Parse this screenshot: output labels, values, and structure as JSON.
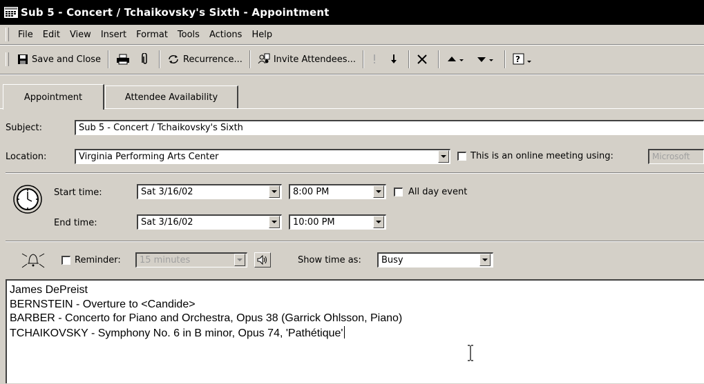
{
  "window": {
    "title": "Sub 5 - Concert / Tchaikovsky's Sixth - Appointment"
  },
  "menu": [
    "File",
    "Edit",
    "View",
    "Insert",
    "Format",
    "Tools",
    "Actions",
    "Help"
  ],
  "toolbar": {
    "save_close_label": "Save and Close",
    "recurrence_label": "Recurrence...",
    "invite_label": "Invite Attendees..."
  },
  "tabs": [
    {
      "label": "Appointment",
      "active": true
    },
    {
      "label": "Attendee Availability",
      "active": false
    }
  ],
  "form": {
    "subject_label": "Subject:",
    "subject_value": "Sub 5 - Concert / Tchaikovsky's Sixth",
    "location_label": "Location:",
    "location_value": "Virginia Performing Arts Center",
    "online_meeting_label": "This is an online meeting using:",
    "online_meeting_value": "Microsoft",
    "start_time_label": "Start time:",
    "start_date": "Sat 3/16/02",
    "start_time": "8:00 PM",
    "all_day_label": "All day event",
    "end_time_label": "End time:",
    "end_date": "Sat 3/16/02",
    "end_time": "10:00 PM",
    "reminder_label": "Reminder:",
    "reminder_value": "15 minutes",
    "show_time_as_label": "Show time as:",
    "show_time_as_value": "Busy"
  },
  "notes": [
    "James DePreist",
    "BERNSTEIN - Overture to <Candide>",
    "BARBER - Concerto for Piano and Orchestra, Opus 38 (Garrick Ohlsson, Piano)",
    "TCHAIKOVSKY - Symphony No. 6 in B minor, Opus 74, 'Pathétique'"
  ]
}
